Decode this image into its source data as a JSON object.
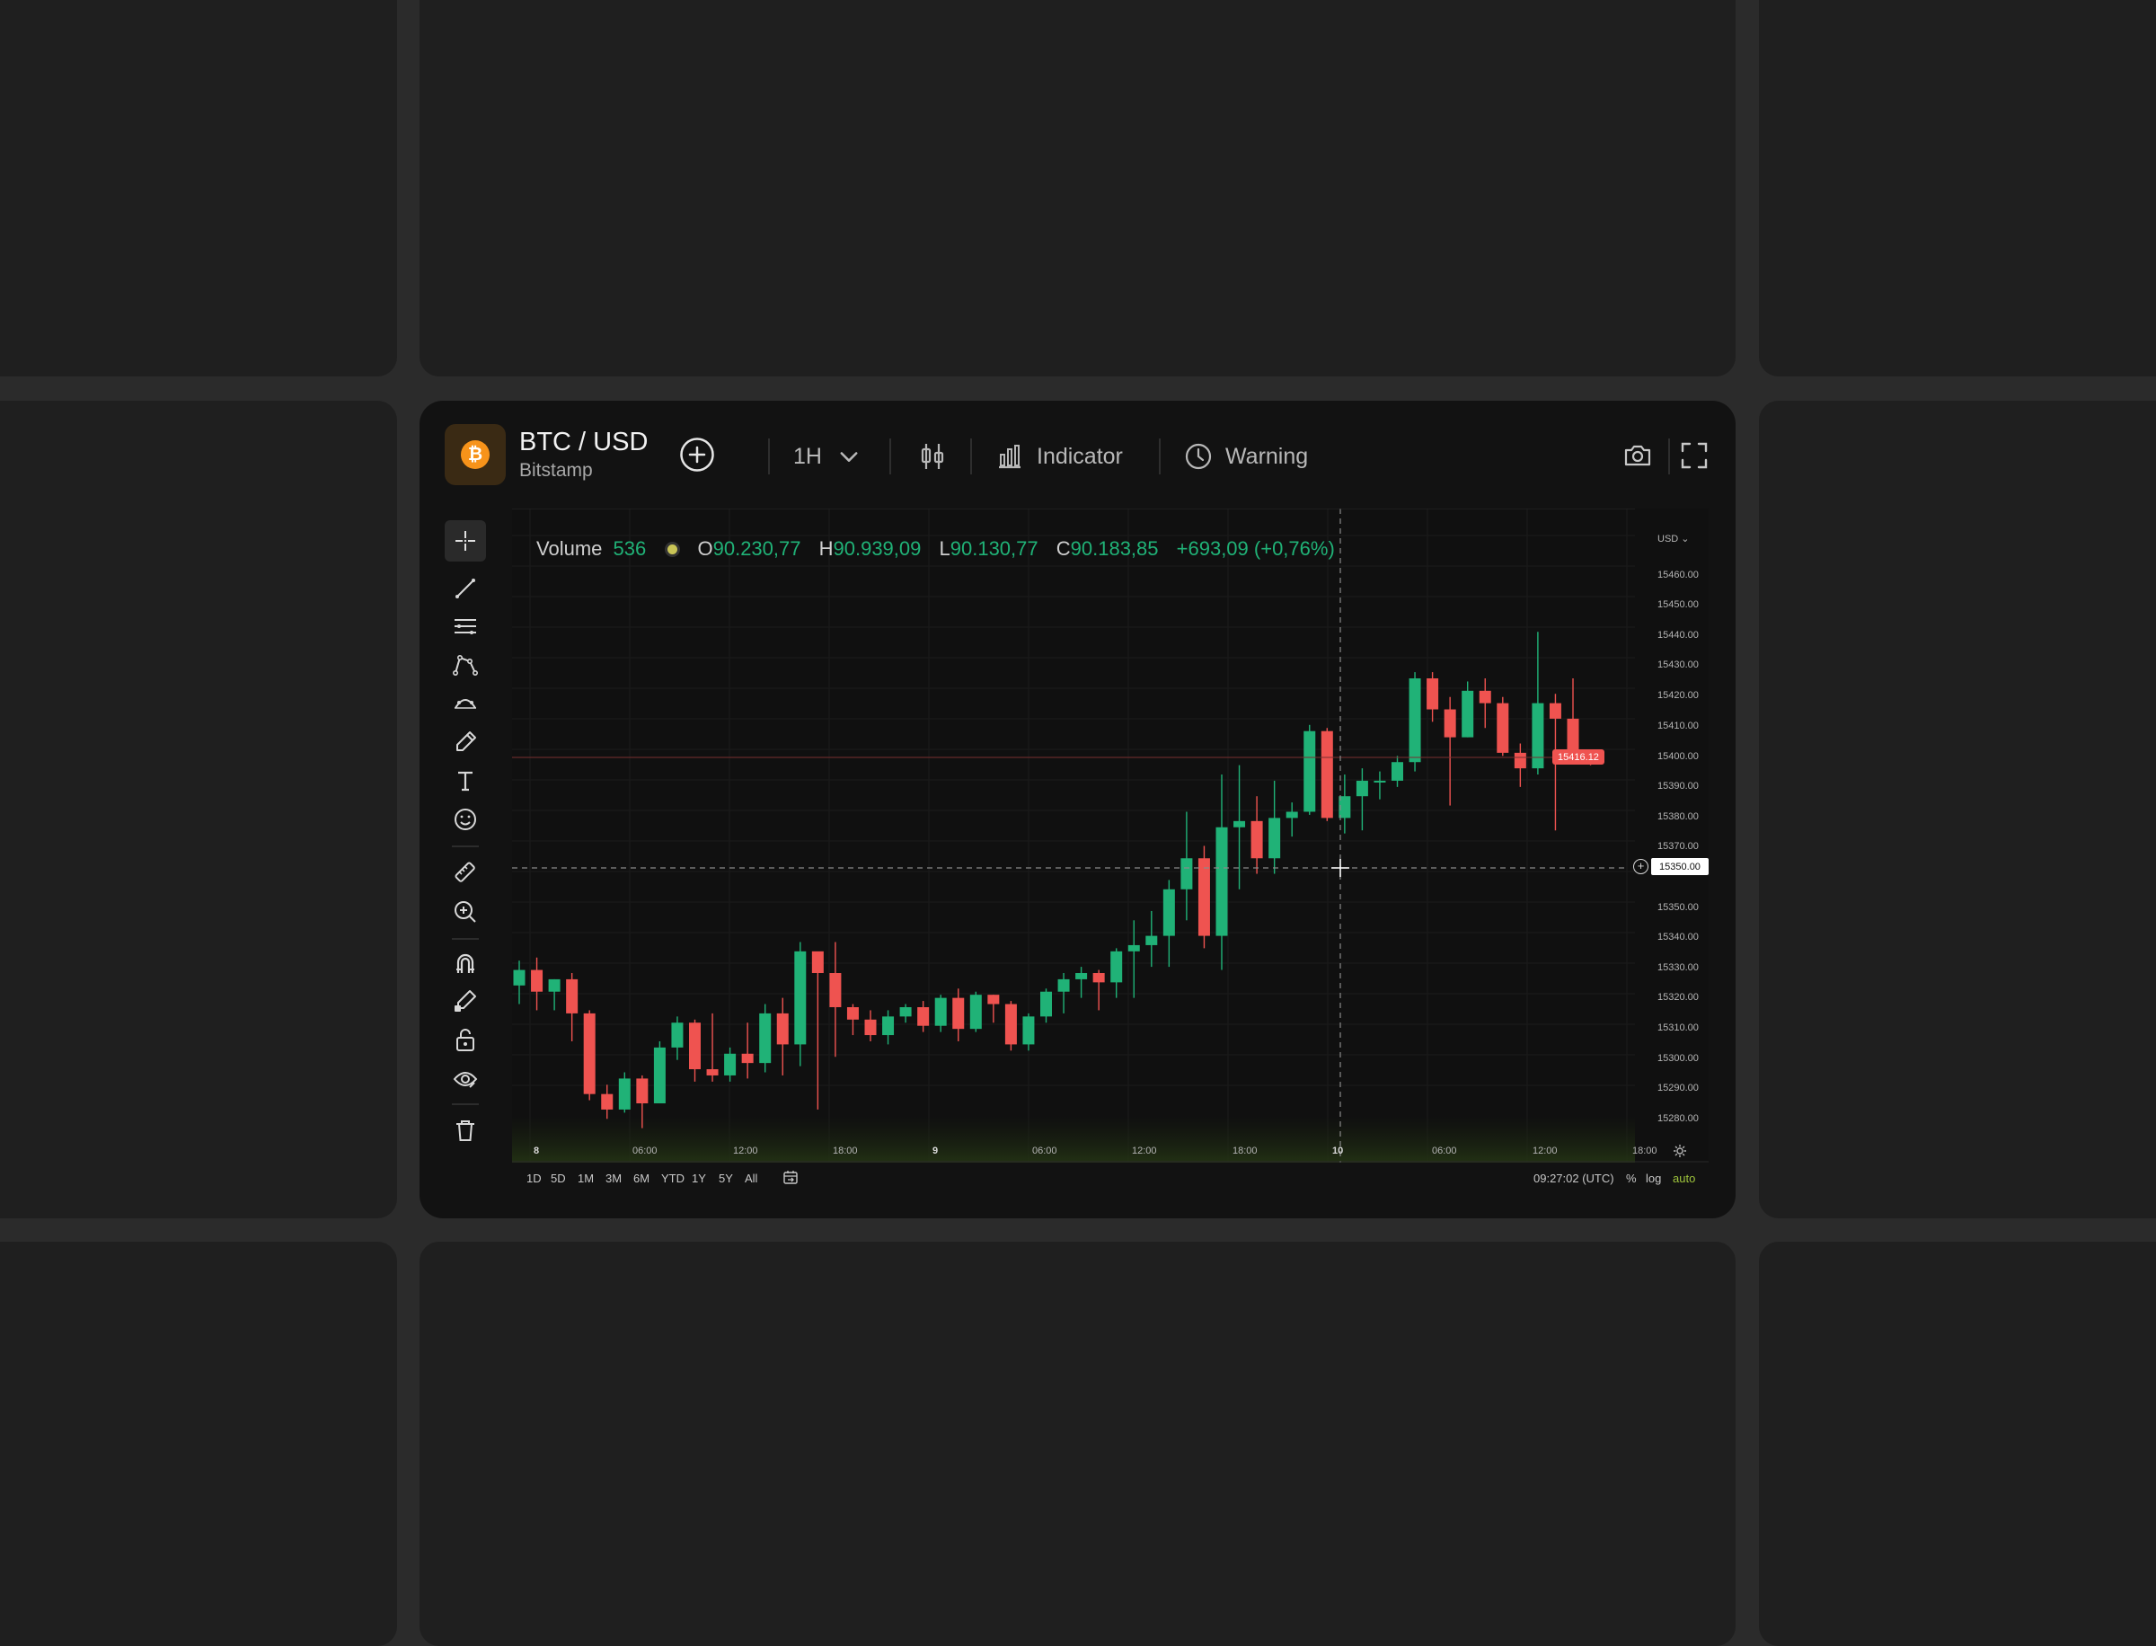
{
  "header": {
    "pair": "BTC / USD",
    "exchange": "Bitstamp",
    "interval": "1H",
    "indicator_label": "Indicator",
    "warning_label": "Warning"
  },
  "legend": {
    "volume_label": "Volume",
    "volume_value": "536",
    "open_label": "O",
    "open_value": "90.230,77",
    "high_label": "H",
    "high_value": "90.939,09",
    "low_label": "L",
    "low_value": "90.130,77",
    "close_label": "C",
    "close_value": "90.183,85",
    "change": "+693,09 (+0,76%)"
  },
  "price_axis": {
    "currency": "USD",
    "ticks": [
      "15460.00",
      "15450.00",
      "15440.00",
      "15430.00",
      "15420.00",
      "15410.00",
      "15400.00",
      "15390.00",
      "15380.00",
      "15370.00",
      "15350.00",
      "15340.00",
      "15330.00",
      "15320.00",
      "15310.00",
      "15300.00",
      "15290.00",
      "15280.00"
    ],
    "current_price": "15416.12",
    "crosshair_price": "15350.00"
  },
  "time_axis": {
    "ticks": [
      "8",
      "06:00",
      "12:00",
      "18:00",
      "9",
      "06:00",
      "12:00",
      "18:00",
      "10",
      "06:00",
      "12:00",
      "18:00"
    ]
  },
  "ranges": [
    "1D",
    "5D",
    "1M",
    "3M",
    "6M",
    "YTD",
    "1Y",
    "5Y",
    "All"
  ],
  "footer": {
    "time": "09:27:02 (UTC)",
    "percent": "%",
    "log": "log",
    "auto": "auto"
  },
  "colors": {
    "up": "#20b277",
    "down": "#ef5350",
    "auto": "#9ec43c",
    "btc": "#f7931a"
  },
  "chart_data": {
    "type": "candlestick",
    "y_range": [
      15275,
      15465
    ],
    "candles": [
      [
        15324,
        15329,
        15318,
        15332
      ],
      [
        15329,
        15322,
        15316,
        15333
      ],
      [
        15322,
        15326,
        15316,
        15326
      ],
      [
        15326,
        15315,
        15306,
        15328
      ],
      [
        15315,
        15289,
        15287,
        15316
      ],
      [
        15289,
        15284,
        15281,
        15292
      ],
      [
        15284,
        15294,
        15283,
        15296
      ],
      [
        15294,
        15286,
        15278,
        15295
      ],
      [
        15286,
        15304,
        15286,
        15306
      ],
      [
        15304,
        15312,
        15300,
        15314
      ],
      [
        15312,
        15297,
        15293,
        15313
      ],
      [
        15297,
        15295,
        15293,
        15315
      ],
      [
        15295,
        15302,
        15293,
        15304
      ],
      [
        15302,
        15299,
        15294,
        15312
      ],
      [
        15299,
        15315,
        15296,
        15318
      ],
      [
        15315,
        15305,
        15295,
        15320
      ],
      [
        15305,
        15335,
        15298,
        15338
      ],
      [
        15335,
        15328,
        15284,
        15329
      ],
      [
        15328,
        15317,
        15301,
        15338
      ],
      [
        15317,
        15313,
        15308,
        15318
      ],
      [
        15313,
        15308,
        15306,
        15316
      ],
      [
        15308,
        15314,
        15305,
        15316
      ],
      [
        15314,
        15317,
        15312,
        15318
      ],
      [
        15317,
        15311,
        15309,
        15319
      ],
      [
        15311,
        15320,
        15309,
        15321
      ],
      [
        15320,
        15310,
        15306,
        15323
      ],
      [
        15310,
        15321,
        15309,
        15322
      ],
      [
        15321,
        15318,
        15312,
        15321
      ],
      [
        15318,
        15305,
        15303,
        15319
      ],
      [
        15305,
        15314,
        15303,
        15315
      ],
      [
        15314,
        15322,
        15312,
        15323
      ],
      [
        15322,
        15326,
        15315,
        15328
      ],
      [
        15326,
        15328,
        15320,
        15330
      ],
      [
        15328,
        15325,
        15316,
        15329
      ],
      [
        15325,
        15335,
        15320,
        15336
      ],
      [
        15335,
        15337,
        15320,
        15345
      ],
      [
        15337,
        15340,
        15330,
        15348
      ],
      [
        15340,
        15355,
        15330,
        15358
      ],
      [
        15355,
        15365,
        15345,
        15380
      ],
      [
        15365,
        15340,
        15336,
        15369
      ],
      [
        15340,
        15375,
        15329,
        15392
      ],
      [
        15375,
        15377,
        15355,
        15395
      ],
      [
        15377,
        15365,
        15360,
        15385
      ],
      [
        15365,
        15378,
        15360,
        15390
      ],
      [
        15378,
        15380,
        15372,
        15383
      ],
      [
        15380,
        15406,
        15379,
        15408
      ],
      [
        15406,
        15378,
        15377,
        15407
      ],
      [
        15378,
        15385,
        15373,
        15392
      ],
      [
        15385,
        15390,
        15374,
        15394
      ],
      [
        15390,
        15390,
        15384,
        15393
      ],
      [
        15390,
        15396,
        15388,
        15398
      ],
      [
        15396,
        15423,
        15393,
        15425
      ],
      [
        15423,
        15413,
        15409,
        15425
      ],
      [
        15413,
        15404,
        15382,
        15417
      ],
      [
        15404,
        15419,
        15404,
        15422
      ],
      [
        15419,
        15415,
        15407,
        15423
      ],
      [
        15415,
        15399,
        15398,
        15417
      ],
      [
        15399,
        15394,
        15388,
        15402
      ],
      [
        15394,
        15415,
        15392,
        15438
      ],
      [
        15415,
        15410,
        15374,
        15418
      ],
      [
        15410,
        15399,
        15396,
        15423
      ],
      [
        15399,
        15396,
        15395,
        15400
      ]
    ]
  }
}
